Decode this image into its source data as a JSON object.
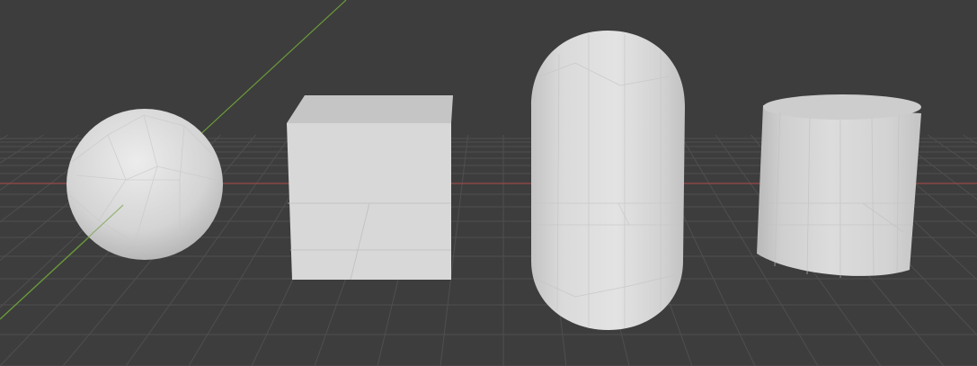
{
  "viewport": {
    "background": "#3d3d3d",
    "grid_color": "#4d4d4d",
    "axis_x_color": "#9a4a4a",
    "axis_y_color": "#6a9a3a",
    "object_color": "#d7d7d7"
  },
  "objects": [
    {
      "type": "ico-sphere"
    },
    {
      "type": "cube"
    },
    {
      "type": "capsule"
    },
    {
      "type": "cylinder"
    }
  ]
}
